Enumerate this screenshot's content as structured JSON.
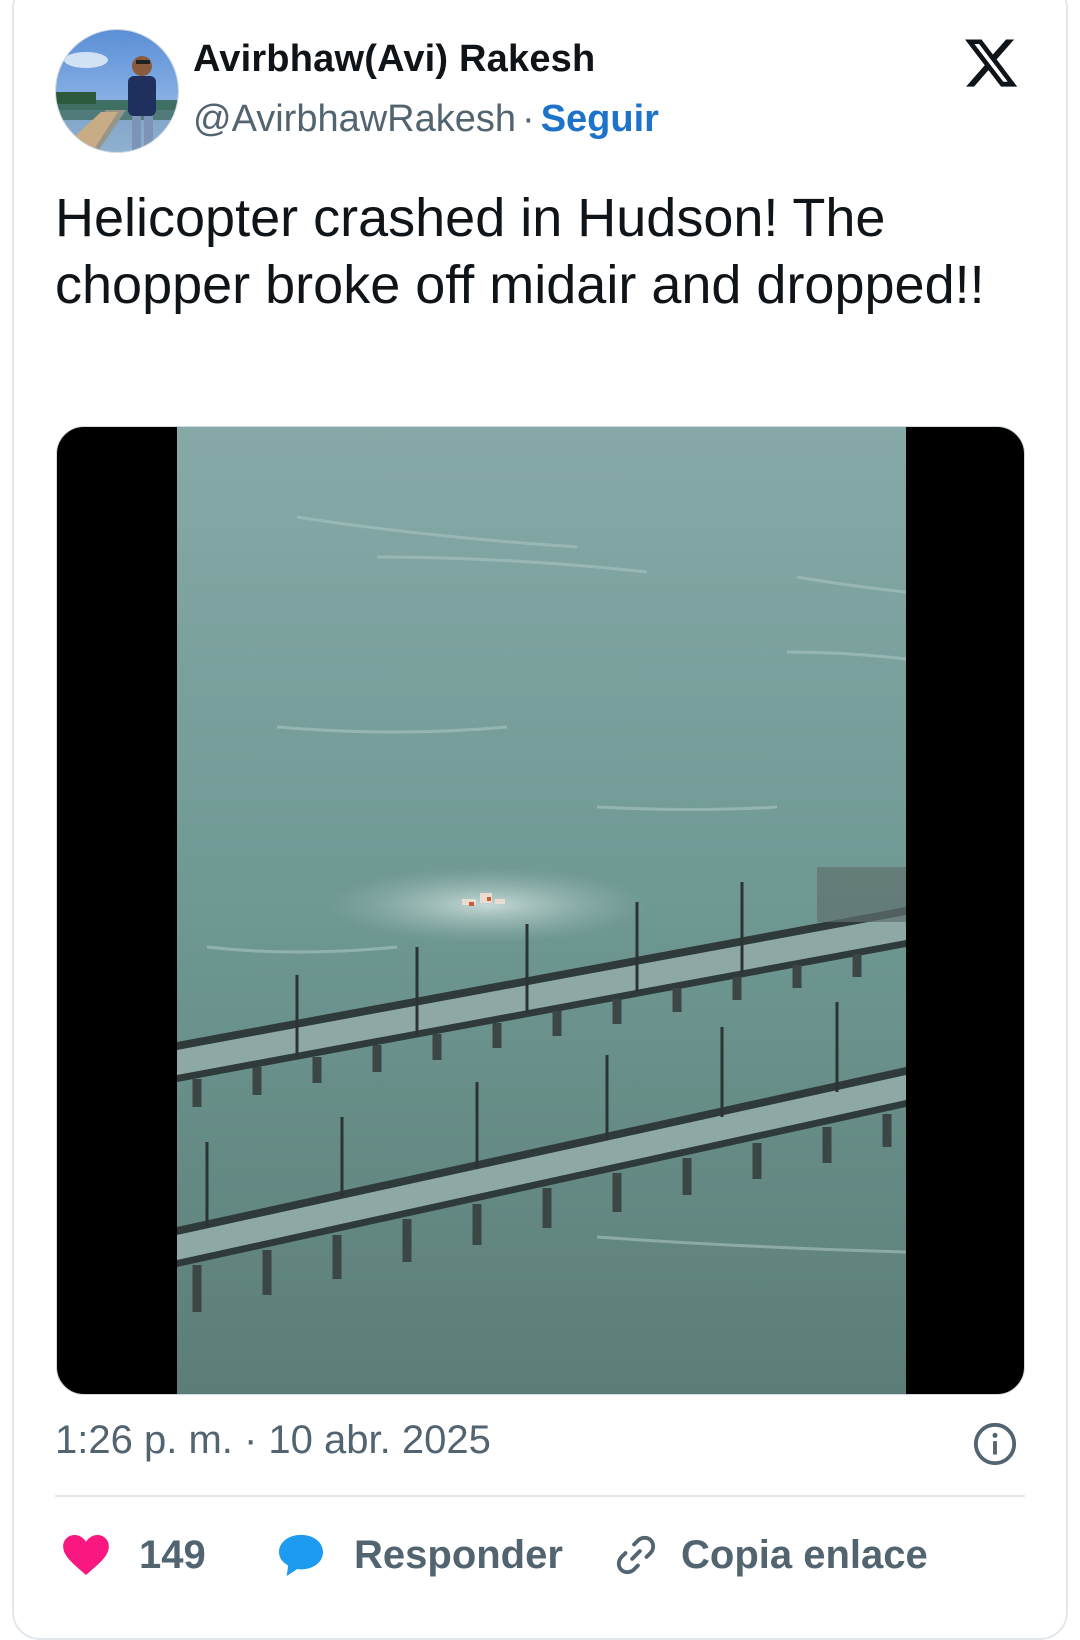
{
  "author": {
    "name": "Avirbhaw(Avi) Rakesh",
    "handle": "@AvirbhawRakesh",
    "separator": "·",
    "follow_label": "Seguir"
  },
  "platform_icon": "x-logo-icon",
  "tweet": {
    "text": "Helicopter crashed in Hudson! The chopper broke off midair and dropped!!",
    "media_icon": "video-thumbnail"
  },
  "meta": {
    "timestamp": "1:26 p. m. · 10 abr. 2025",
    "info_icon": "info-icon"
  },
  "actions": {
    "like": {
      "icon": "heart-icon",
      "count": "149"
    },
    "reply": {
      "icon": "speech-bubble-icon",
      "label": "Responder"
    },
    "copy": {
      "icon": "link-icon",
      "label": "Copia enlace"
    }
  },
  "colors": {
    "follow": "#1d73c9",
    "like": "#f91880",
    "reply": "#1d9bf0",
    "secondary_text": "#536471",
    "primary_text": "#0f1419",
    "water": "#6f9590"
  }
}
